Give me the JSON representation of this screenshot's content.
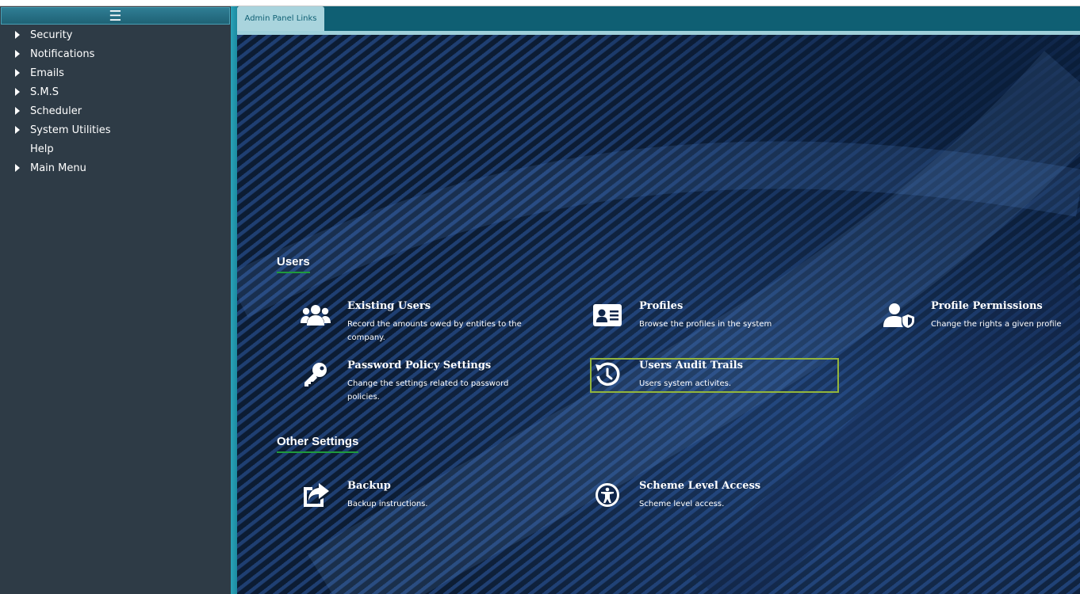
{
  "sidebar": {
    "menu_icon": "hamburger-icon",
    "items": [
      {
        "label": "Security",
        "has_arrow": true
      },
      {
        "label": "Notifications",
        "has_arrow": true
      },
      {
        "label": "Emails",
        "has_arrow": true
      },
      {
        "label": "S.M.S",
        "has_arrow": true
      },
      {
        "label": "Scheduler",
        "has_arrow": true
      },
      {
        "label": "System Utilities",
        "has_arrow": true
      },
      {
        "label": "Help",
        "has_arrow": false
      },
      {
        "label": "Main Menu",
        "has_arrow": true
      }
    ]
  },
  "tabs": [
    {
      "label": "Admin Panel Links",
      "active": true
    }
  ],
  "sections": {
    "users": {
      "title": "Users",
      "cards": [
        {
          "title": "Existing Users",
          "desc": "Record the amounts owed by entities to the company.",
          "icon": "users-group-icon"
        },
        {
          "title": "Profiles",
          "desc": "Browse the profiles in the system",
          "icon": "id-card-icon"
        },
        {
          "title": "Profile Permissions",
          "desc": "Change the rights a given profile",
          "icon": "user-shield-icon"
        },
        {
          "title": "Password Policy Settings",
          "desc": "Change the settings related to password policies.",
          "icon": "key-icon"
        },
        {
          "title": "Users Audit Trails",
          "desc": "Users system activites.",
          "icon": "history-icon",
          "focused": true
        }
      ]
    },
    "other": {
      "title": "Other Settings",
      "cards": [
        {
          "title": "Backup",
          "desc": "Backup instructions.",
          "icon": "share-export-icon"
        },
        {
          "title": "Scheme Level Access",
          "desc": "Scheme level access.",
          "icon": "accessibility-icon"
        }
      ]
    }
  },
  "colors": {
    "sidebar_bg": "#2e3b46",
    "tab_strip": "#0f5f73",
    "tab_active": "#a9d4dd",
    "section_underline": "#1f9a3c",
    "focus_outline": "#93b53b"
  }
}
